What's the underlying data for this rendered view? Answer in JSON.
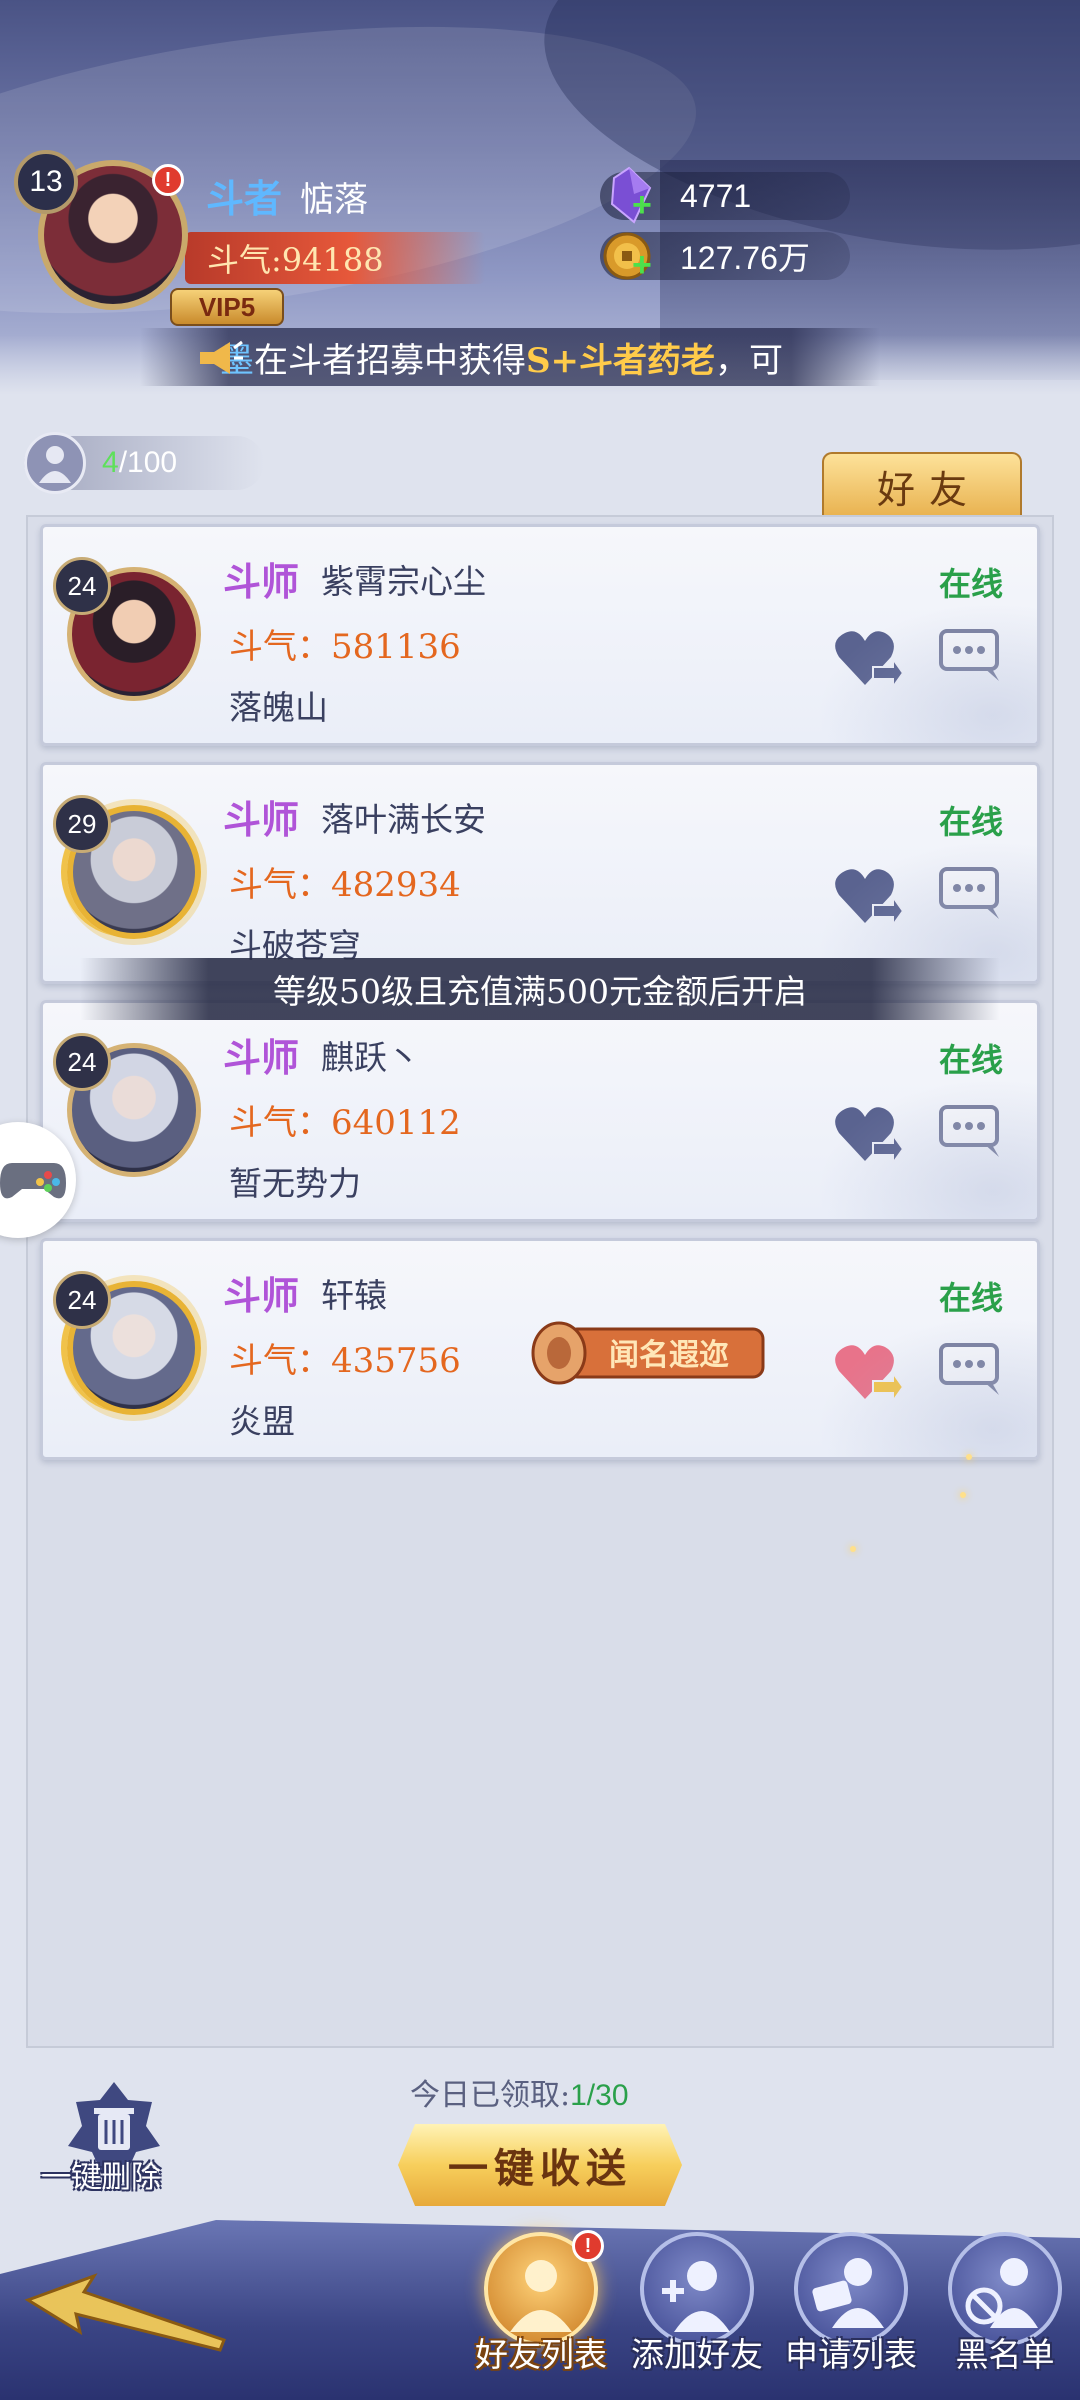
{
  "header": {
    "level": "13",
    "rank": "斗者",
    "name": "惦落",
    "power": "斗气:94188",
    "vip": "VIP5",
    "alert": "!",
    "crystals": "4771",
    "gold": "127.76万",
    "ticker": {
      "name": "墨",
      "text_before": "在斗者招募中获得",
      "highlight": "S+斗者药老",
      "text_after": "，可"
    }
  },
  "panel": {
    "friend_count_current": "4",
    "friend_count_total": "/100",
    "tab_label": "好友",
    "locked_banner": "等级50级且充值满500元金额后开启"
  },
  "friends": [
    {
      "level": "24",
      "rank": "斗师",
      "name": "紫霄宗心尘",
      "power": "斗气：581136",
      "guild": "落魄山",
      "status": "在线"
    },
    {
      "level": "29",
      "rank": "斗师",
      "name": "落叶满长安",
      "power": "斗气：482934",
      "guild": "斗破苍穹",
      "status": "在线"
    },
    {
      "level": "24",
      "rank": "斗师",
      "name": "麒跃丶",
      "power": "斗气：640112",
      "guild": "暂无势力",
      "status": "在线"
    },
    {
      "level": "24",
      "rank": "斗师",
      "name": "轩辕",
      "power": "斗气：435756",
      "guild": "炎盟",
      "status": "在线",
      "title_badge": "闻名遐迩"
    }
  ],
  "actions": {
    "claimed_label": "今日已领取:",
    "claimed_value": "1/30",
    "send_all": "一键收送",
    "delete_all": "一键删除"
  },
  "nav": {
    "items": [
      {
        "label": "好友列表",
        "active": true
      },
      {
        "label": "添加好友"
      },
      {
        "label": "申请列表"
      },
      {
        "label": "黑名单"
      }
    ],
    "alert": "!"
  },
  "colors": {
    "online": "#2aa04a",
    "power": "#e4671f",
    "rank_purple": "#b054d8",
    "accent_gold": "#f7cf5c"
  }
}
